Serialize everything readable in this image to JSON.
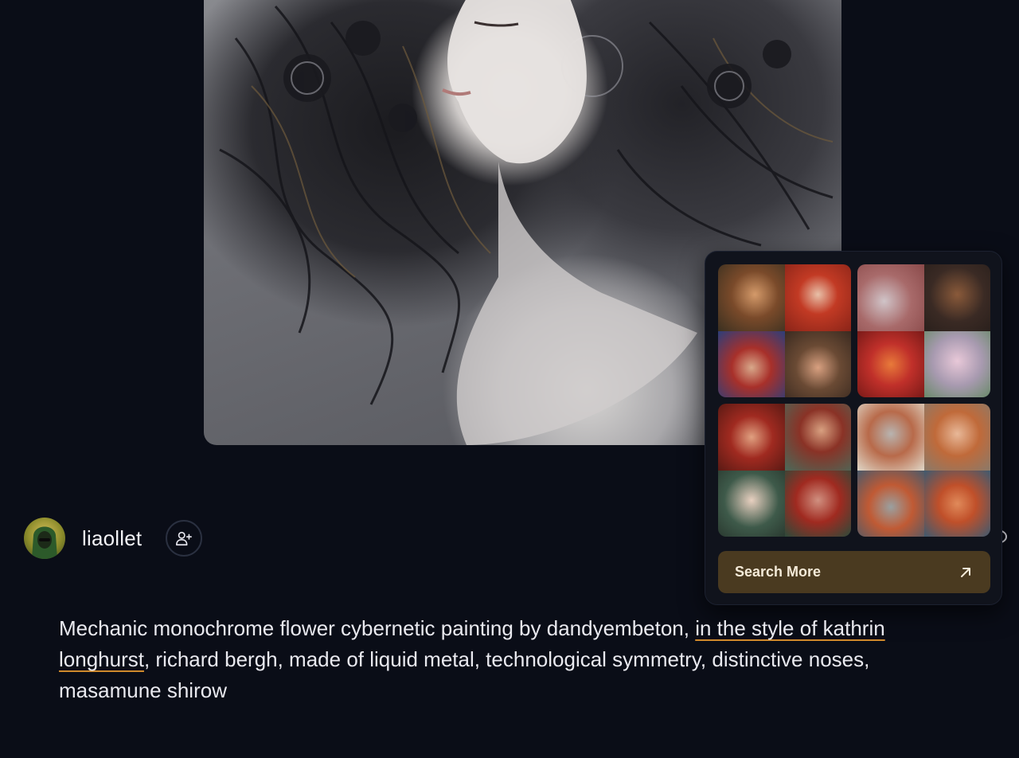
{
  "artwork": {
    "alt": "cyberpunk-woman-artwork"
  },
  "creator": {
    "username": "liaollet",
    "avatar_icon": "avatar-image",
    "follow_icon": "user-plus-icon"
  },
  "similar_popover": {
    "tiles": [
      {
        "colors": [
          "#7a4a2a",
          "#b23a26",
          "#3b4e7a",
          "#6a4a34"
        ]
      },
      {
        "colors": [
          "#b8a8a8",
          "#3a2a24",
          "#c0302a",
          "#a89ab0"
        ]
      },
      {
        "colors": [
          "#a02a20",
          "#8a3226",
          "#3e5a4a",
          "#2c4a3a"
        ]
      },
      {
        "colors": [
          "#b8a090",
          "#c06a3a",
          "#6a7a8a",
          "#3e5a70"
        ]
      }
    ],
    "search_more_label": "Search More",
    "search_more_icon": "arrow-up-right-icon"
  },
  "prompt": {
    "part1": "Mechanic monochrome flower cybernetic painting by dandyembeton, ",
    "highlight": "in the style of kathrin longhurst",
    "part2": ", richard bergh, made of liquid metal, technological symmetry, distinctive noses, masamune shirow"
  },
  "colors": {
    "background": "#0a0d17",
    "accent_underline": "#d08a2c",
    "search_more_bg": "#4a3a20"
  }
}
